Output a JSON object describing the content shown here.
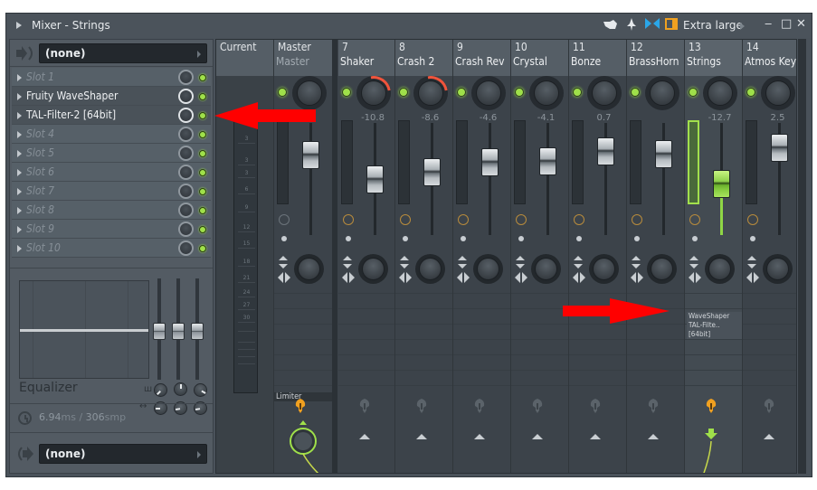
{
  "window": {
    "title": "Mixer - Strings",
    "size_label": "Extra large",
    "toolbar_icons": [
      "hand-pointer-icon",
      "pin-icon",
      "bowtie-link-icon",
      "panel-layout-icon"
    ],
    "controls": [
      "minimize-icon",
      "maximize-icon",
      "close-icon"
    ],
    "control_glyphs": [
      "‒",
      "□",
      "✕"
    ]
  },
  "insert_panel": {
    "input": {
      "label": "(none)"
    },
    "slots": [
      {
        "label": "Slot 1",
        "empty": true
      },
      {
        "label": "Fruity WaveShaper",
        "empty": false
      },
      {
        "label": "TAL-Filter-2 [64bit]",
        "empty": false
      },
      {
        "label": "Slot 4",
        "empty": true
      },
      {
        "label": "Slot 5",
        "empty": true
      },
      {
        "label": "Slot 6",
        "empty": true
      },
      {
        "label": "Slot 7",
        "empty": true
      },
      {
        "label": "Slot 8",
        "empty": true
      },
      {
        "label": "Slot 9",
        "empty": true
      },
      {
        "label": "Slot 10",
        "empty": true
      }
    ],
    "equalizer": {
      "label": "Equalizer",
      "band_gains": [
        0,
        0,
        0
      ]
    },
    "latency": {
      "ms": "6.94",
      "ms_unit": "ms",
      "sep": " / ",
      "samples": "306",
      "samples_unit": "smp"
    },
    "output": {
      "label": "(none)"
    }
  },
  "mixer": {
    "current_label": "Current",
    "current_scale": [
      "3",
      "3",
      "3",
      "6",
      "9",
      "12",
      "15",
      "18",
      "21",
      "24",
      "27",
      "30"
    ],
    "tracks": [
      {
        "num": "",
        "name": "Master",
        "subname": "Master",
        "volume_db": "",
        "fader_pos": 0.78,
        "pan_arc": false,
        "fx_active": false,
        "fx_list": "",
        "route": "Limiter",
        "route_active": true,
        "selected": false
      },
      {
        "num": "7",
        "name": "Shaker",
        "volume_db": "-10.8",
        "fader_pos": 0.5,
        "pan_arc": true,
        "fx_active": true,
        "selected": false
      },
      {
        "num": "8",
        "name": "Crash 2",
        "volume_db": "-8.6",
        "fader_pos": 0.58,
        "pan_arc": true,
        "fx_active": true,
        "selected": false
      },
      {
        "num": "9",
        "name": "Crash Rev",
        "volume_db": "-4.6",
        "fader_pos": 0.7,
        "pan_arc": false,
        "fx_active": true,
        "selected": false
      },
      {
        "num": "10",
        "name": "Crystal",
        "volume_db": "-4.1",
        "fader_pos": 0.71,
        "pan_arc": false,
        "fx_active": true,
        "selected": false
      },
      {
        "num": "11",
        "name": "Bonze",
        "volume_db": "0.7",
        "fader_pos": 0.83,
        "pan_arc": false,
        "fx_active": true,
        "selected": false
      },
      {
        "num": "12",
        "name": "BrassHorn",
        "volume_db": "",
        "fader_pos": 0.8,
        "pan_arc": false,
        "fx_active": true,
        "selected": false
      },
      {
        "num": "13",
        "name": "Strings",
        "volume_db": "-12.7",
        "fader_pos": 0.44,
        "pan_arc": false,
        "fx_active": true,
        "selected": true,
        "fx_list": "WaveShaper\nTAL-Filte..[64bit]"
      },
      {
        "num": "14",
        "name": "Atmos Keys",
        "volume_db": "2.5",
        "fader_pos": 0.87,
        "pan_arc": false,
        "fx_active": true,
        "selected": false
      }
    ],
    "fx_list_line1": "WaveShaper",
    "fx_list_line2": "TAL-Filte..[64bit]"
  },
  "colors": {
    "led_green": "#9fe04a",
    "pan_arc_red": "#f0543c",
    "fx_clock_orange": "#b88b3c",
    "annotation_red": "#ff0000",
    "selected_fader_green": "#8fd14b"
  }
}
